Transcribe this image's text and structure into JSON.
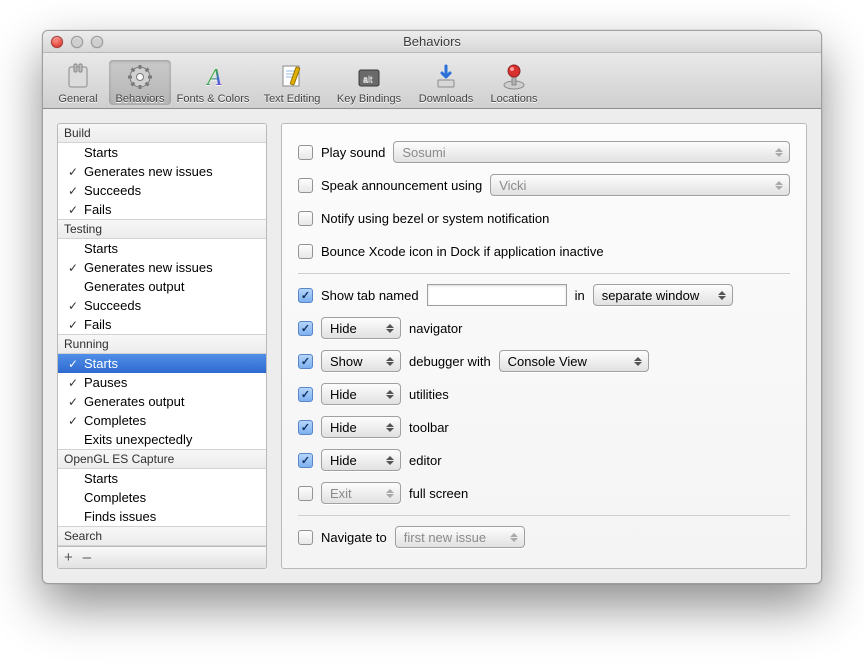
{
  "window": {
    "title": "Behaviors"
  },
  "toolbar": {
    "items": [
      {
        "label": "General"
      },
      {
        "label": "Behaviors"
      },
      {
        "label": "Fonts & Colors"
      },
      {
        "label": "Text Editing"
      },
      {
        "label": "Key Bindings"
      },
      {
        "label": "Downloads"
      },
      {
        "label": "Locations"
      }
    ],
    "selected_index": 1
  },
  "sidebar": {
    "groups": [
      {
        "title": "Build",
        "items": [
          {
            "label": "Starts",
            "checked": false
          },
          {
            "label": "Generates new issues",
            "checked": true
          },
          {
            "label": "Succeeds",
            "checked": true
          },
          {
            "label": "Fails",
            "checked": true
          }
        ]
      },
      {
        "title": "Testing",
        "items": [
          {
            "label": "Starts",
            "checked": false
          },
          {
            "label": "Generates new issues",
            "checked": true
          },
          {
            "label": "Generates output",
            "checked": false
          },
          {
            "label": "Succeeds",
            "checked": true
          },
          {
            "label": "Fails",
            "checked": true
          }
        ]
      },
      {
        "title": "Running",
        "items": [
          {
            "label": "Starts",
            "checked": true,
            "selected": true
          },
          {
            "label": "Pauses",
            "checked": true
          },
          {
            "label": "Generates output",
            "checked": true
          },
          {
            "label": "Completes",
            "checked": true
          },
          {
            "label": "Exits unexpectedly",
            "checked": false
          }
        ]
      },
      {
        "title": "OpenGL ES Capture",
        "items": [
          {
            "label": "Starts",
            "checked": false
          },
          {
            "label": "Completes",
            "checked": false
          },
          {
            "label": "Finds issues",
            "checked": false
          }
        ]
      },
      {
        "title": "Search",
        "items": []
      }
    ],
    "footer": {
      "add": "+",
      "remove": "–"
    }
  },
  "detail": {
    "play_sound": {
      "label": "Play sound",
      "value": "Sosumi",
      "checked": false
    },
    "speak": {
      "label": "Speak announcement using",
      "value": "Vicki",
      "checked": false
    },
    "notify": {
      "label": "Notify using bezel or system notification",
      "checked": false
    },
    "bounce": {
      "label": "Bounce Xcode icon in Dock if application inactive",
      "checked": false
    },
    "show_tab": {
      "label": "Show tab named",
      "checked": true,
      "value": "",
      "in": "in",
      "where": "separate window"
    },
    "navigator": {
      "checked": true,
      "action": "Hide",
      "label": "navigator"
    },
    "debugger": {
      "checked": true,
      "action": "Show",
      "label": "debugger with",
      "view": "Console View"
    },
    "utilities": {
      "checked": true,
      "action": "Hide",
      "label": "utilities"
    },
    "toolbar": {
      "checked": true,
      "action": "Hide",
      "label": "toolbar"
    },
    "editor": {
      "checked": true,
      "action": "Hide",
      "label": "editor"
    },
    "fullscreen": {
      "checked": false,
      "action": "Exit",
      "label": "full screen"
    },
    "navigate_to": {
      "checked": false,
      "label": "Navigate to",
      "value": "first new issue"
    }
  }
}
